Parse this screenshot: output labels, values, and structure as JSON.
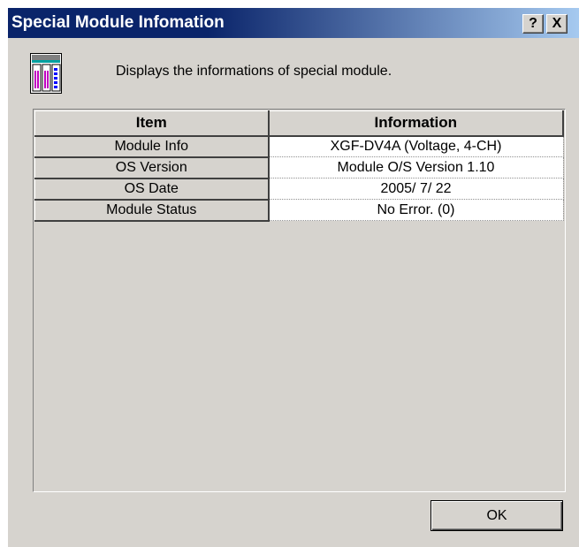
{
  "window": {
    "title": "Special Module Infomation",
    "help_label": "?",
    "close_label": "X"
  },
  "description": "Displays the informations of special module.",
  "table": {
    "headers": [
      "Item",
      "Information"
    ],
    "rows": [
      {
        "item": "Module Info",
        "info": "XGF-DV4A (Voltage, 4-CH)"
      },
      {
        "item": "OS Version",
        "info": "Module O/S Version  1.10"
      },
      {
        "item": "OS Date",
        "info": "2005/ 7/ 22"
      },
      {
        "item": "Module Status",
        "info": "No Error. (0)"
      }
    ]
  },
  "ok_label": "OK",
  "icon": "module-icon",
  "colors": {
    "title_bar_start": "#0a246a",
    "title_bar_end": "#a6caf0",
    "dialog_face": "#d6d3ce"
  }
}
